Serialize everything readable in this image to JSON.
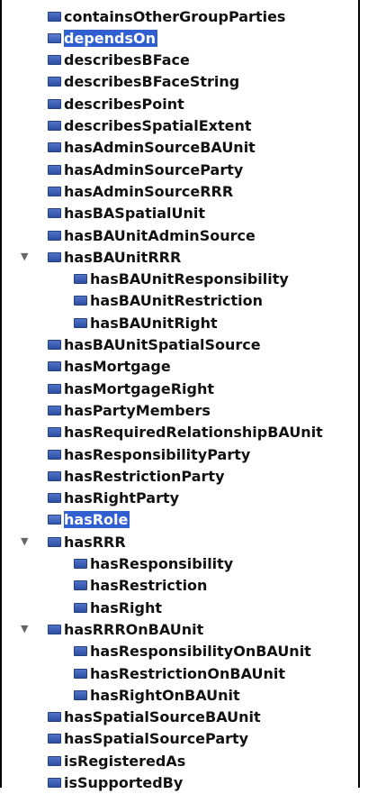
{
  "items": [
    {
      "label": "containsOtherGroupParties"
    },
    {
      "label": "dependsOn",
      "selected": true
    },
    {
      "label": "describesBFace"
    },
    {
      "label": "describesBFaceString"
    },
    {
      "label": "describesPoint"
    },
    {
      "label": "describesSpatialExtent"
    },
    {
      "label": "hasAdminSourceBAUnit"
    },
    {
      "label": "hasAdminSourceParty"
    },
    {
      "label": "hasAdminSourceRRR"
    },
    {
      "label": "hasBASpatialUnit"
    },
    {
      "label": "hasBAUnitAdminSource"
    },
    {
      "label": "hasBAUnitRRR",
      "expanded": true,
      "children": [
        {
          "label": "hasBAUnitResponsibility"
        },
        {
          "label": "hasBAUnitRestriction"
        },
        {
          "label": "hasBAUnitRight"
        }
      ]
    },
    {
      "label": "hasBAUnitSpatialSource"
    },
    {
      "label": "hasMortgage"
    },
    {
      "label": "hasMortgageRight"
    },
    {
      "label": "hasPartyMembers"
    },
    {
      "label": "hasRequiredRelationshipBAUnit"
    },
    {
      "label": "hasResponsibilityParty"
    },
    {
      "label": "hasRestrictionParty"
    },
    {
      "label": "hasRightParty"
    },
    {
      "label": "hasRole",
      "selected": true
    },
    {
      "label": "hasRRR",
      "expanded": true,
      "children": [
        {
          "label": "hasResponsibility"
        },
        {
          "label": "hasRestriction"
        },
        {
          "label": "hasRight"
        }
      ]
    },
    {
      "label": "hasRRROnBAUnit",
      "expanded": true,
      "children": [
        {
          "label": "hasResponsibilityOnBAUnit"
        },
        {
          "label": "hasRestrictionOnBAUnit"
        },
        {
          "label": "hasRightOnBAUnit"
        }
      ]
    },
    {
      "label": "hasSpatialSourceBAUnit"
    },
    {
      "label": "hasSpatialSourceParty"
    },
    {
      "label": "isRegisteredAs"
    },
    {
      "label": "isSupportedBy"
    }
  ],
  "icons": {
    "node": "property-icon",
    "expand": "triangle-down-icon"
  },
  "colors": {
    "selection": "#2f5fd0",
    "icon": "#3a5fb8"
  }
}
